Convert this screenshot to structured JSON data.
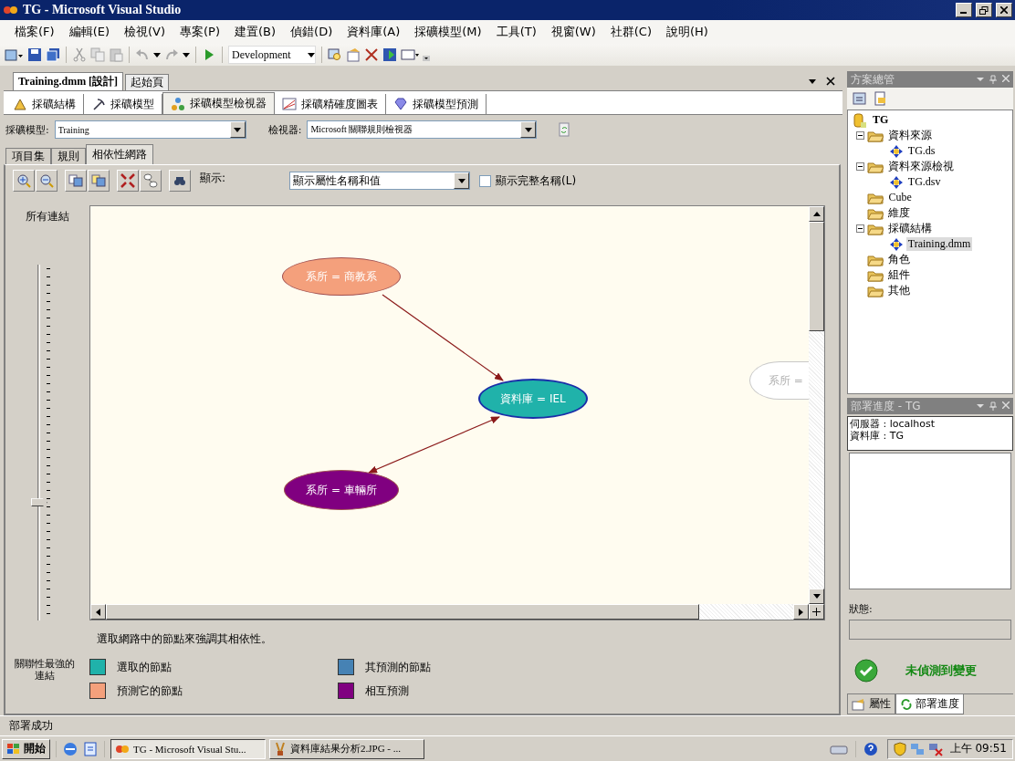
{
  "window": {
    "title": "TG - Microsoft Visual Studio"
  },
  "menu": [
    "檔案(F)",
    "編輯(E)",
    "檢視(V)",
    "專案(P)",
    "建置(B)",
    "偵錯(D)",
    "資料庫(A)",
    "採礦模型(M)",
    "工具(T)",
    "視窗(W)",
    "社群(C)",
    "說明(H)"
  ],
  "toolbar": {
    "configuration": "Development"
  },
  "document_tabs": [
    {
      "label": "Training.dmm [設計]",
      "selected": true
    },
    {
      "label": "起始頁",
      "selected": false
    }
  ],
  "designer_tabs": [
    {
      "label": "採礦結構",
      "selected": false
    },
    {
      "label": "採礦模型",
      "selected": false
    },
    {
      "label": "採礦模型檢視器",
      "selected": true
    },
    {
      "label": "採礦精確度圖表",
      "selected": false
    },
    {
      "label": "採礦模型預測",
      "selected": false
    }
  ],
  "model_row": {
    "model_label": "採礦模型:",
    "model_value": "Training",
    "viewer_label": "檢視器:",
    "viewer_value": "Microsoft 關聯規則檢視器"
  },
  "viewer_tabs": [
    {
      "label": "項目集",
      "selected": false
    },
    {
      "label": "規則",
      "selected": false
    },
    {
      "label": "相依性網路",
      "selected": true
    }
  ],
  "viewer_toolbar": {
    "show_label": "顯示:",
    "show_value": "顯示屬性名稱和值",
    "full_names": {
      "label": "顯示完整名稱(L)",
      "checked": false
    }
  },
  "links_slider": {
    "label": "所有連結",
    "level": 0.33
  },
  "network": {
    "nodes": [
      {
        "label": "系所 = 商教系",
        "color": "#f4a07c",
        "selected": false
      },
      {
        "label": "資料庫 = IEL",
        "color": "#20b2aa",
        "selected": true
      },
      {
        "label": "系所 = 車輛所",
        "color": "#800080",
        "selected": false
      },
      {
        "label": "系所 =",
        "color": "#ffffff",
        "selected": false
      }
    ]
  },
  "hint": "選取網路中的節點來強調其相依性。",
  "legend": {
    "title": "關聯性最強的連結",
    "items": [
      {
        "label": "選取的節點",
        "color": "#20b2aa"
      },
      {
        "label": "其預測的節點",
        "color": "#4682b4"
      },
      {
        "label": "預測它的節點",
        "color": "#f4a07c"
      },
      {
        "label": "相互預測",
        "color": "#800080"
      }
    ]
  },
  "solution_explorer": {
    "title": "方案總管",
    "tree": [
      {
        "label": "TG",
        "selected": false,
        "children": [
          {
            "label": "資料來源",
            "selected": false,
            "expanded": true,
            "children": [
              {
                "label": "TG.ds",
                "selected": false
              }
            ]
          },
          {
            "label": "資料來源檢視",
            "selected": false,
            "expanded": true,
            "children": [
              {
                "label": "TG.dsv",
                "selected": false
              }
            ]
          },
          {
            "label": "Cube",
            "selected": false
          },
          {
            "label": "維度",
            "selected": false
          },
          {
            "label": "採礦結構",
            "selected": false,
            "expanded": true,
            "children": [
              {
                "label": "Training.dmm",
                "selected": true
              }
            ]
          },
          {
            "label": "角色",
            "selected": false
          },
          {
            "label": "組件",
            "selected": false
          },
          {
            "label": "其他",
            "selected": false
          }
        ]
      }
    ]
  },
  "deploy": {
    "title": "部署進度 - TG",
    "lines": [
      "伺服器 : localhost",
      "資料庫 : TG"
    ],
    "status_label": "狀態:",
    "result": "未偵測到變更"
  },
  "panel_tabs": [
    {
      "label": "屬性",
      "selected": false
    },
    {
      "label": "部署進度",
      "selected": true
    }
  ],
  "status_bar": "部署成功",
  "taskbar": {
    "start": "開始",
    "tasks": [
      {
        "label": "TG - Microsoft Visual Stu...",
        "selected": true
      },
      {
        "label": "資料庫結果分析2.JPG - ...",
        "selected": false
      }
    ],
    "clock": "上午 09:51"
  }
}
